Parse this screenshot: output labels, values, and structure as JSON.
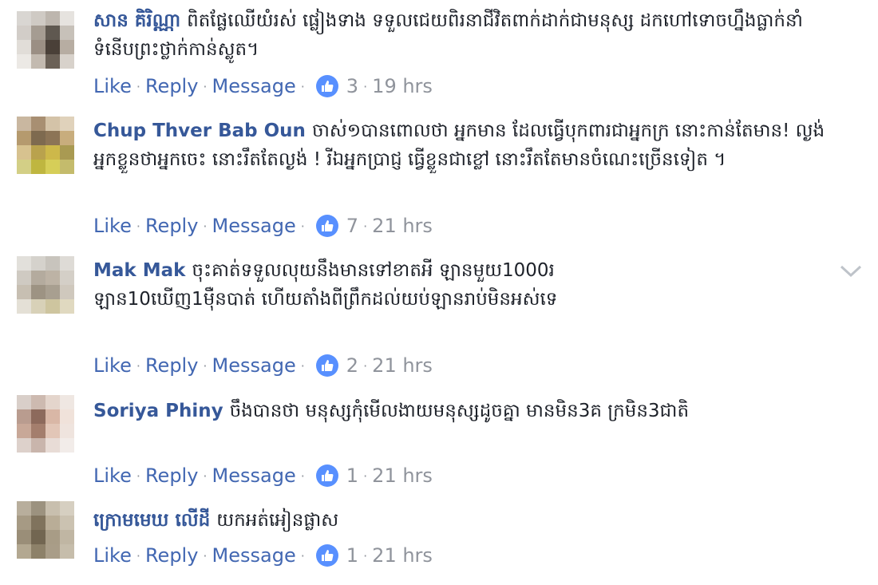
{
  "comments": [
    {
      "name": "សាន គិរិណ្ណា",
      "text": "ពិតផ្លែឈើយំរស់ ផ្លៀងទាង ទទួលជេយពិរនាជីវិតពាក់ដាក់ជាមនុស្ស ដកហៅទោចហ្នឹងធ្លាក់នាំ ទំនើបព្រះថ្លាក់កាន់ស្លូត។",
      "like": "Like",
      "reply": "Reply",
      "message": "Message",
      "likes": "3",
      "time": "19 hrs",
      "avatar_colors": [
        "#d9d6d2",
        "#cfcac4",
        "#bdb6ae",
        "#e6e3df",
        "#d2cdc8",
        "#a59c92",
        "#5f5850",
        "#c7c1b9",
        "#e1ddd8",
        "#9b8f84",
        "#4a4038",
        "#b7ada2",
        "#ece9e5",
        "#c3bab0",
        "#6b6157",
        "#d8d2cb"
      ]
    },
    {
      "name": "Chup Thver Bab Oun",
      "text": "ចាស់១បានពោលថា អ្នកមាន ដែលធ្វើបុកពារជាអ្នកក្រ នោះកាន់តែមាន! ល្ងង់ អ្នកខ្លួនថាអ្នកចេះ នោះរឹតតែល្ងង់ ! រីឯអ្នកប្រាជ្ញ ធ្វើខ្លួនជាខ្លៅ នោះរឹតតែមានចំណេះច្រើនទៀត ។",
      "like": "Like",
      "reply": "Reply",
      "message": "Message",
      "likes": "7",
      "time": "21 hrs",
      "avatar_colors": [
        "#c9b7a0",
        "#a88f72",
        "#d4c3a8",
        "#e0d2bb",
        "#b59a6e",
        "#7e6a4f",
        "#8c7456",
        "#c8ad7d",
        "#d7c28f",
        "#b9a24d",
        "#cdb84a",
        "#a99a52",
        "#d3cf86",
        "#bfb640",
        "#d6ce58",
        "#c4bb6c"
      ]
    },
    {
      "name": "Mak Mak",
      "text": "ចុះគាត់ទទួលលុយនឹងមានទៅខាតអី ឡានមួយ1000រ ឡាន10ឃើញ1ម៉ឺនបាត់ ហើយតាំងពីព្រឹកដល់យប់ឡានរាប់មិនអស់ទេ",
      "like": "Like",
      "reply": "Reply",
      "message": "Message",
      "likes": "2",
      "time": "21 hrs",
      "avatar_colors": [
        "#e2e0db",
        "#d5d2cc",
        "#c8c4bd",
        "#dedbd6",
        "#cfcac2",
        "#b4ab9e",
        "#bdb3a5",
        "#d4cfc7",
        "#c7bfb2",
        "#9d9383",
        "#a89f90",
        "#cfc8bd",
        "#e4e0d6",
        "#d8d1b8",
        "#cec59f",
        "#e0d9c0"
      ]
    },
    {
      "name": "Soriya Phiny",
      "text": "ចឹងបានថា មនុស្សកុំមើលងាយមនុស្សដូចគ្នា មានមិន3គ ក្រមិន3ជាតិ",
      "like": "Like",
      "reply": "Reply",
      "message": "Message",
      "likes": "1",
      "time": "21 hrs",
      "avatar_colors": [
        "#d9cfc9",
        "#cdbab0",
        "#e4d5cc",
        "#efe7e2",
        "#b99c8f",
        "#8d6a5c",
        "#d9b7a6",
        "#f0e2da",
        "#c8a898",
        "#a47e6d",
        "#e2c6b7",
        "#efe4de",
        "#ddd1cb",
        "#c9b5ac",
        "#e8dcd6",
        "#f2ece9"
      ]
    },
    {
      "name": "ក្រោមមេឃ លើដី",
      "text": "យកអត់អៀនផ្លាស",
      "like": "Like",
      "reply": "Reply",
      "message": "Message",
      "likes": "1",
      "time": "21 hrs",
      "avatar_colors": [
        "#b8ae9c",
        "#9c927f",
        "#c8bfae",
        "#d6cfc1",
        "#a69a84",
        "#80735d",
        "#b9ad97",
        "#cbc2b1",
        "#9a8e78",
        "#726651",
        "#a89c86",
        "#c0b6a3",
        "#b3a891",
        "#8d8169",
        "#a99d88",
        "#c6bdab"
      ]
    }
  ],
  "colors": {
    "name": "#365899",
    "action": "#4267b2",
    "meta": "#90949c",
    "like_badge": "#5890ff"
  },
  "icons": {
    "like_badge": "thumbs-up-icon",
    "options": "chevron-down-icon"
  }
}
